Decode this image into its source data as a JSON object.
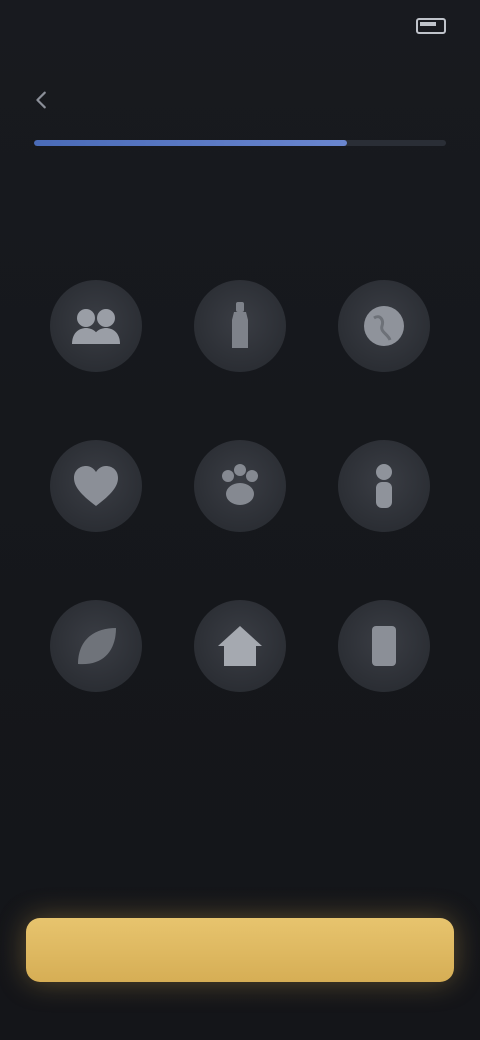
{
  "status_bar": {
    "time": "",
    "indicators": ""
  },
  "nav": {
    "skip_label": ""
  },
  "progress": {
    "fraction": 0.76
  },
  "header": {
    "title": ""
  },
  "causes": [
    {
      "icon": "people-icon",
      "label": ""
    },
    {
      "icon": "bottle-icon",
      "label": ""
    },
    {
      "icon": "globe-icon",
      "label": ""
    },
    {
      "icon": "heart-icon",
      "label": ""
    },
    {
      "icon": "paw-icon",
      "label": ""
    },
    {
      "icon": "person-icon",
      "label": ""
    },
    {
      "icon": "leaf-icon",
      "label": ""
    },
    {
      "icon": "home-icon",
      "label": ""
    },
    {
      "icon": "book-icon",
      "label": ""
    }
  ],
  "footer": {
    "continue_label": ""
  },
  "colors": {
    "background": "#16181d",
    "accent": "#6f8fd6",
    "button": "#e0bb63"
  }
}
